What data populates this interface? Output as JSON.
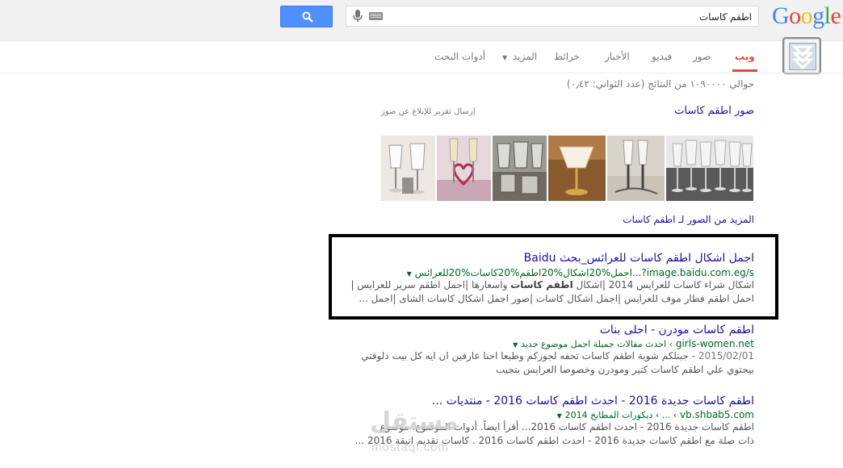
{
  "logo": {
    "letters": [
      "G",
      "o",
      "o",
      "g",
      "l",
      "e"
    ],
    "colors": [
      "#4285f4",
      "#ea4335",
      "#fbbc05",
      "#4285f4",
      "#34a853",
      "#ea4335"
    ]
  },
  "search": {
    "query": "اطقم كاسات",
    "button_icon": "search-icon"
  },
  "tabs": [
    {
      "label": "ويب",
      "active": true
    },
    {
      "label": "صور"
    },
    {
      "label": "فيديو"
    },
    {
      "label": "الأخبار"
    },
    {
      "label": "خرائط"
    },
    {
      "label": "المزيد"
    },
    {
      "label": "أدوات البحث"
    }
  ],
  "stats": "حوالي ١٠٩٠٠٠٠ من النتائج (عدد الثواني: ٠٫٤٢)",
  "images_block": {
    "title": "صور اطقم كاسات",
    "report": "إرسال تقرير للإبلاغ عن صور",
    "more": "المزيد من الصور لـ اطقم كاسات",
    "thumbs": [
      {
        "desc": "crystal-goblets-set"
      },
      {
        "desc": "wedding-flutes-ribbon"
      },
      {
        "desc": "wedding-flutes-gold"
      },
      {
        "desc": "cut-crystal-glasses"
      },
      {
        "desc": "champagne-glasses-heart"
      },
      {
        "desc": "glass-set-tray"
      }
    ]
  },
  "results": [
    {
      "title": "اجمل اشكال اطقم كاسات للعرائس_بحث Baidu",
      "url_main": "image.baidu.com.eg/s?...اجمل%20اشكال%20اطقم%20كاسات%20للعرائس",
      "snippet1_a": "اشكال شراء كاسات للعرايس 2014 |اشكال ",
      "snippet1_b": "اطقم كاسات",
      "snippet1_c": " واسعارها |اجمل اطقم سرير للعرايس |",
      "snippet2": "احمل اطقم فطار موف للعرايس |اجمل اشكال كاسات |صور اجمل اشكال كاسات الشاى |اجمل ..."
    },
    {
      "title": "اطقم كاسات مودرن - احلى بنات",
      "url_main": "girls-women.net",
      "url_breadcrumb": "› احدث مقالات جميلة اجمل موضوع جديد",
      "date": "2015/02/01 - ",
      "snippet1": "جبتلكم شوية اطقم كاسات تحفه لجوزكم وطبعا احنا عارفين ان ايه كل بيت دلوقتي",
      "snippet2": "بيحتوي علي اطقم كاسات كتير ومودرن وخصوصا العرايس بتجيب"
    },
    {
      "title": "اطقم كاسات جديدة 2016 - احدث اطقم كاسات 2016 - منتديات ...",
      "url_main": "vb.shbab5.com",
      "url_breadcrumb": "› ... › ديكورات المطابخ 2014",
      "snippet1": "اطقم كاسات جديدة 2016 - احدث اطقم كاسات 2016... أقرأ ايضاً. أدوات الموضوع. موضوع",
      "snippet2": "ذات صلة مع اطقم كاسات جديدة 2016 - احدث اطقم كاسات 2016 . كاسات تقديم انيقة 2016 ..."
    }
  ],
  "watermark": {
    "arabic": "مستقل",
    "latin": "mostaql.com"
  }
}
